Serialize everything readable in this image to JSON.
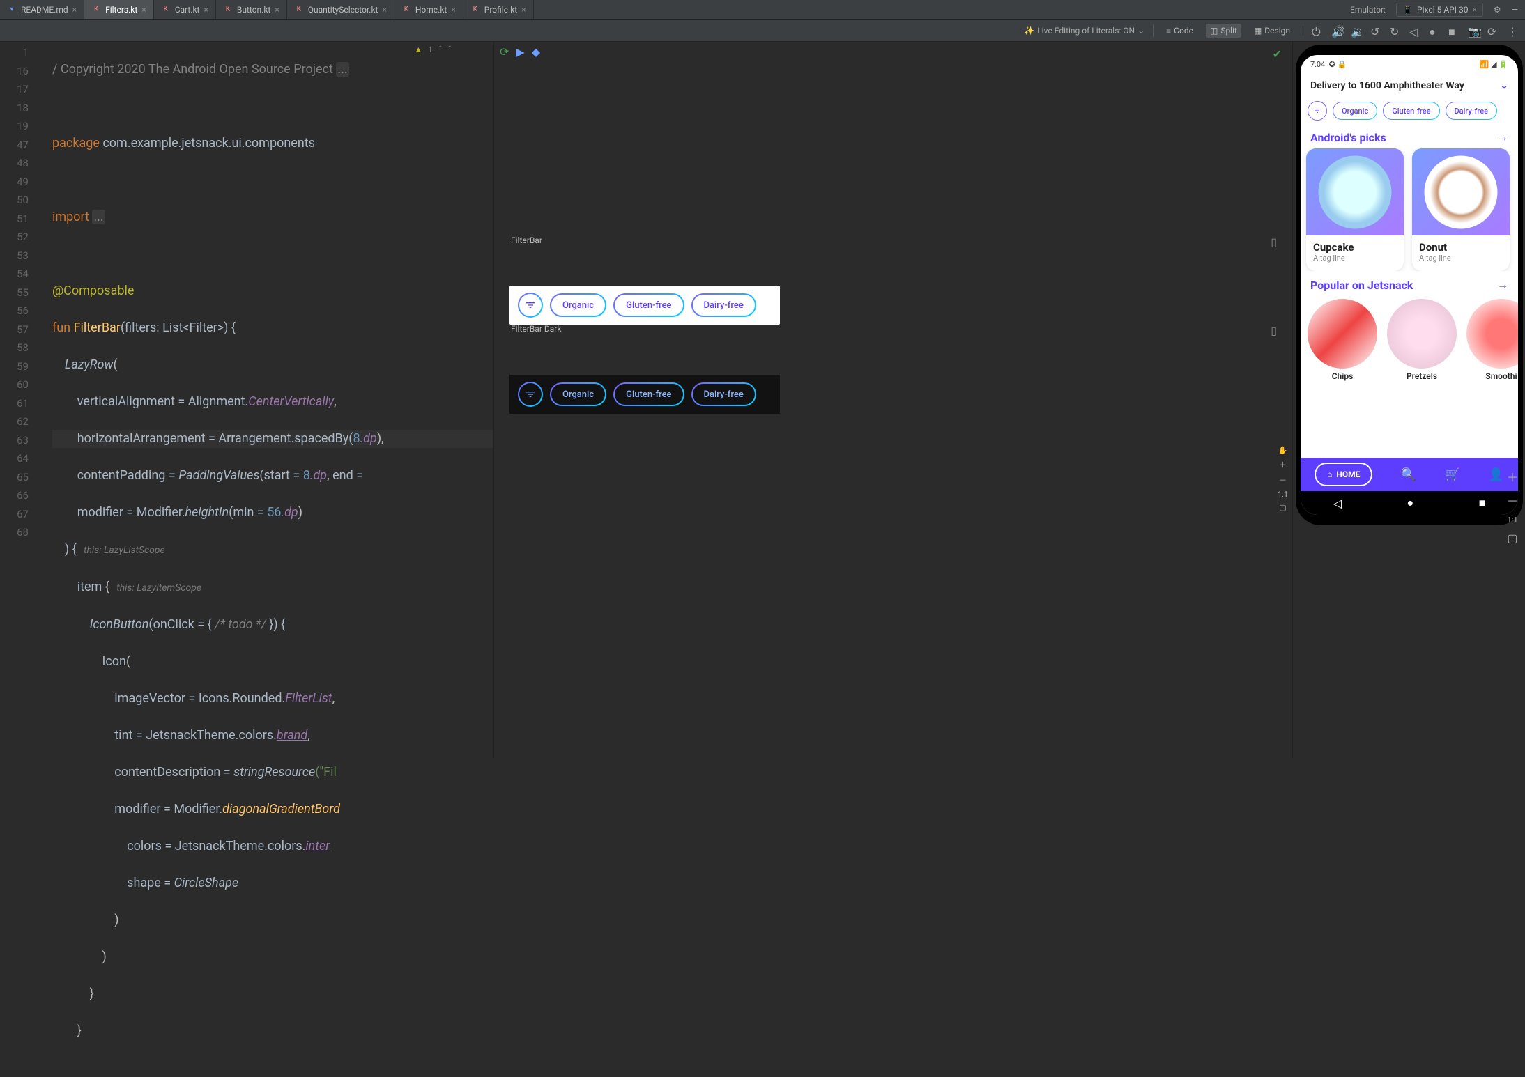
{
  "tabs": [
    {
      "name": "README.md",
      "active": false,
      "icon": "md"
    },
    {
      "name": "Filters.kt",
      "active": true,
      "icon": "kt"
    },
    {
      "name": "Cart.kt",
      "active": false,
      "icon": "kt"
    },
    {
      "name": "Button.kt",
      "active": false,
      "icon": "kt"
    },
    {
      "name": "QuantitySelector.kt",
      "active": false,
      "icon": "kt"
    },
    {
      "name": "Home.kt",
      "active": false,
      "icon": "kt"
    },
    {
      "name": "Profile.kt",
      "active": false,
      "icon": "kt"
    }
  ],
  "emulator": {
    "label": "Emulator:",
    "device": "Pixel 5 API 30"
  },
  "toolbar": {
    "live_edit": "Live Editing of Literals: ON",
    "views": {
      "code": "Code",
      "split": "Split",
      "design": "Design"
    }
  },
  "gutter": [
    "1",
    "16",
    "17",
    "18",
    "19",
    "47",
    "48",
    "49",
    "50",
    "51",
    "52",
    "53",
    "54",
    "55",
    "56",
    "57",
    "58",
    "59",
    "60",
    "61",
    "62",
    "63",
    "64",
    "65",
    "66",
    "67",
    "68"
  ],
  "code": {
    "l1": "/ Copyright 2020 The Android Open Source Project ",
    "l1_fold": "...",
    "l17_pkg": "package",
    "l17_path": " com.example.jetsnack.ui.components",
    "l19_imp": "import ",
    "l19_fold": "...",
    "l48": "@Composable",
    "l49_fun": "fun ",
    "l49_name": "FilterBar",
    "l49_sig": "(filters: List<Filter>) {",
    "l50": "LazyRow",
    "l50_paren": "(",
    "l51_p": "verticalAlignment = ",
    "l51_v": "Alignment.",
    "l51_m": "CenterVertically",
    "l51_c": ",",
    "l52_p": "horizontalArrangement = ",
    "l52_v": "Arrangement.spacedBy(",
    "l52_n": "8",
    "l52_dp": ".dp",
    "l52_c": "),",
    "l53_p": "contentPadding = ",
    "l53_v": "PaddingValues",
    "l53_args": "(start = ",
    "l53_n1": "8",
    "l53_dp1": ".dp",
    "l53_mid": ", end = ",
    "l54_p": "modifier = ",
    "l54_v": "Modifier.",
    "l54_m": "heightIn",
    "l54_args": "(min = ",
    "l54_n": "56",
    "l54_dp": ".dp",
    "l54_end": ")",
    "l55_close": ") {",
    "l55_hint": "   this: LazyListScope",
    "l56_item": "item",
    "l56_brace": " {",
    "l56_hint": "   this: LazyItemScope",
    "l57_ib": "IconButton",
    "l57_args": "(onClick = { ",
    "l57_todo": "/* todo */",
    "l57_end": " }) {",
    "l58": "Icon",
    "l58_p": "(",
    "l59_p": "imageVector = ",
    "l59_v": "Icons.Rounded.",
    "l59_m": "FilterList",
    "l59_c": ",",
    "l60_p": "tint = ",
    "l60_v": "JetsnackTheme.colors.",
    "l60_m": "brand",
    "l60_c": ",",
    "l61_p": "contentDescription = ",
    "l61_v": "stringResource",
    "l61_args": "(\"Fil",
    "l62_p": "modifier = ",
    "l62_v": "Modifier.",
    "l62_m": "diagonalGradientBord",
    "l63_p": "colors = ",
    "l63_v": "JetsnackTheme.colors.",
    "l63_m": "inter",
    "l64_p": "shape = ",
    "l64_v": "CircleShape",
    "l65": ")",
    "l66": ")",
    "l67": "}",
    "l68": "}"
  },
  "inspections": {
    "warn": "1"
  },
  "preview_light": {
    "label": "FilterBar",
    "chips": [
      "Organic",
      "Gluten-free",
      "Dairy-free"
    ]
  },
  "preview_dark": {
    "label": "FilterBar Dark",
    "chips": [
      "Organic",
      "Gluten-free",
      "Dairy-free"
    ]
  },
  "zoom": {
    "ratio": "1:1"
  },
  "app": {
    "time": "7:04",
    "delivery": "Delivery to 1600 Amphitheater Way",
    "filters": [
      "Organic",
      "Gluten-free",
      "Dairy-free"
    ],
    "section1": "Android's picks",
    "cards": [
      {
        "title": "Cupcake",
        "sub": "A tag line"
      },
      {
        "title": "Donut",
        "sub": "A tag line"
      }
    ],
    "section2": "Popular on Jetsnack",
    "snacks": [
      "Chips",
      "Pretzels",
      "Smoothi"
    ],
    "home": "HOME"
  },
  "emulator_zoom": {
    "ratio": "1:1"
  }
}
